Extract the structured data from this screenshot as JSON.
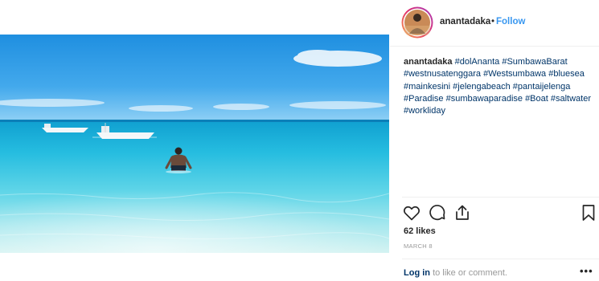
{
  "post": {
    "username": "anantadaka",
    "separator": "•",
    "follow_label": "Follow",
    "caption_user": "anantadaka",
    "hashtags": [
      "#dolAnanta",
      "#SumbawaBarat",
      "#westnusatenggara",
      "#Westsumbawa",
      "#bluesea",
      "#mainkesini",
      "#jelengabeach",
      "#pantaijelenga",
      "#Paradise",
      "#sumbawaparadise",
      "#Boat",
      "#saltwater",
      "#workliday"
    ],
    "likes": "62 likes",
    "date": "MARCH 8",
    "login_label": "Log in",
    "comment_suffix": "to like or comment.",
    "more_label": "•••"
  },
  "colors": {
    "accent": "#3897f0",
    "link": "#003569",
    "text": "#262626",
    "muted": "#999999"
  },
  "icons": {
    "like": "heart-icon",
    "comment": "comment-icon",
    "share": "share-icon",
    "save": "bookmark-icon"
  }
}
